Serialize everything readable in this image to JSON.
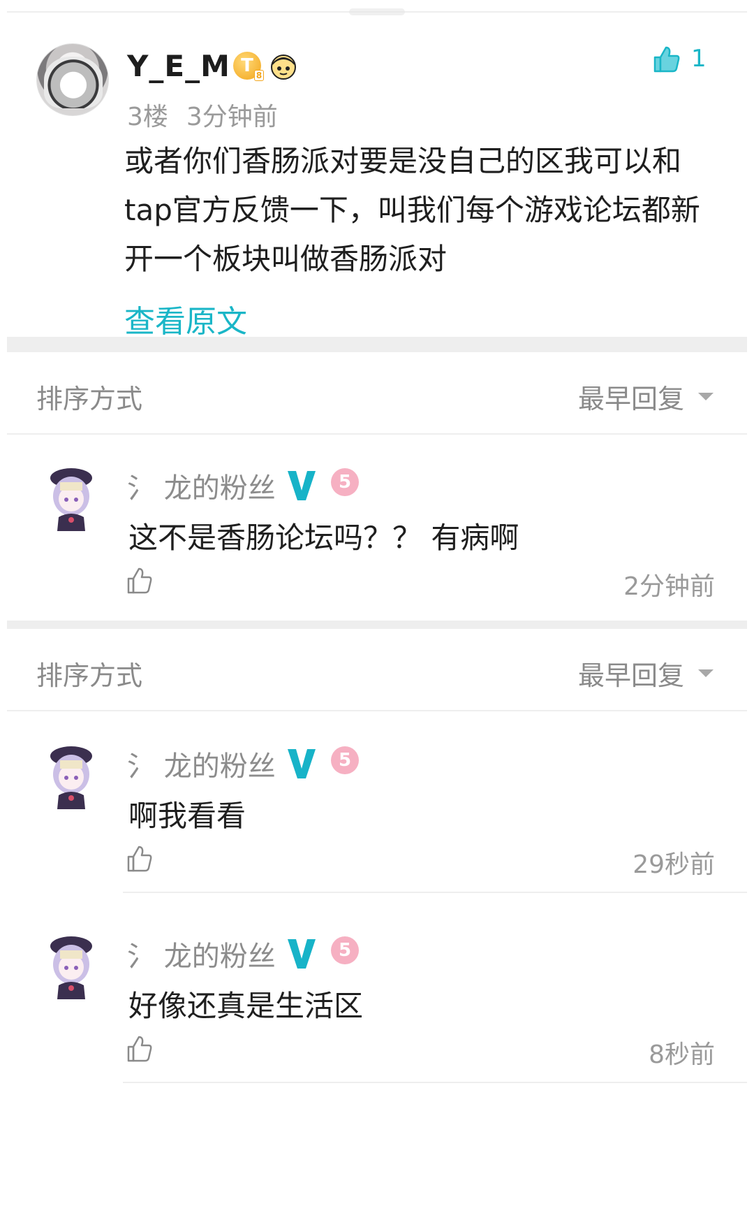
{
  "post": {
    "username": "Y_E_M",
    "badge_letter": "T",
    "badge_level": "8",
    "like_count": "1",
    "floor": "3楼",
    "time": "3分钟前",
    "content": "或者你们香肠派对要是没自己的区我可以和tap官方反馈一下，叫我们每个游戏论坛都新开一个板块叫做香肠派对",
    "view_original": "查看原文"
  },
  "sort_sections": [
    {
      "label": "排序方式",
      "value": "最早回复"
    },
    {
      "label": "排序方式",
      "value": "最早回复"
    }
  ],
  "replies": [
    {
      "name": "氵 龙的粉丝",
      "level": "5",
      "text": "这不是香肠论坛吗？？ 有病啊",
      "time": "2分钟前"
    },
    {
      "name": "氵 龙的粉丝",
      "level": "5",
      "text": "啊我看看",
      "time": "29秒前"
    },
    {
      "name": "氵 龙的粉丝",
      "level": "5",
      "text": "好像还真是生活区",
      "time": "8秒前"
    }
  ],
  "colors": {
    "accent": "#1ab6c7",
    "vip_v": "#17b3c8",
    "level_badge": "#f6b0c2",
    "gold_badge": "#f2a51b",
    "muted_text": "#9a9a9a",
    "divider": "#eeeeee"
  },
  "icons": {
    "like": "thumbs-up-icon",
    "sort_caret": "caret-down-icon",
    "vip": "vip-v-icon"
  }
}
